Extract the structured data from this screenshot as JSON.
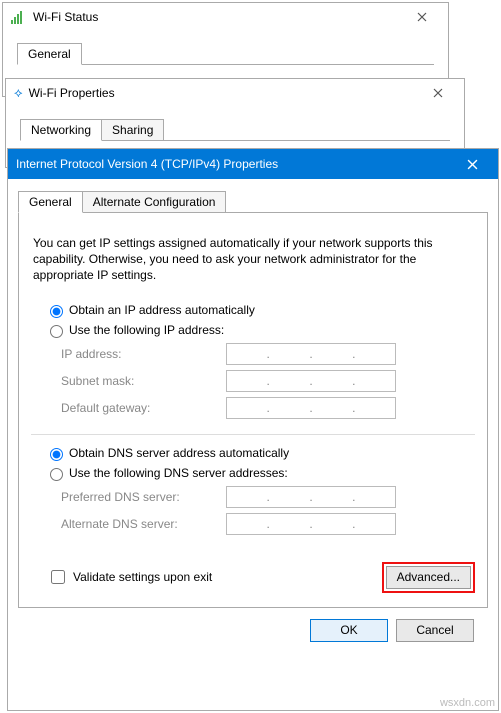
{
  "status_window": {
    "title": "Wi-Fi Status",
    "tabs": {
      "general": "General"
    }
  },
  "props_window": {
    "title": "Wi-Fi Properties",
    "tabs": {
      "networking": "Networking",
      "sharing": "Sharing"
    }
  },
  "ipv4_window": {
    "title": "Internet Protocol Version 4 (TCP/IPv4) Properties",
    "tabs": {
      "general": "General",
      "alt": "Alternate Configuration"
    },
    "info_text": "You can get IP settings assigned automatically if your network supports this capability. Otherwise, you need to ask your network administrator for the appropriate IP settings.",
    "ip": {
      "auto_label": "Obtain an IP address automatically",
      "manual_label": "Use the following IP address:",
      "fields": {
        "ip_address": "IP address:",
        "subnet": "Subnet mask:",
        "gateway": "Default gateway:"
      }
    },
    "dns": {
      "auto_label": "Obtain DNS server address automatically",
      "manual_label": "Use the following DNS server addresses:",
      "fields": {
        "preferred": "Preferred DNS server:",
        "alternate": "Alternate DNS server:"
      }
    },
    "validate_label": "Validate settings upon exit",
    "advanced_label": "Advanced...",
    "ok_label": "OK",
    "cancel_label": "Cancel"
  },
  "watermark": "wsxdn.com"
}
